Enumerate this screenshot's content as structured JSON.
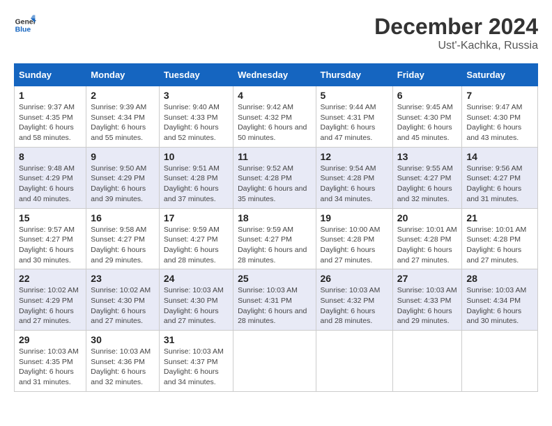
{
  "logo": {
    "line1": "General",
    "line2": "Blue"
  },
  "title": "December 2024",
  "subtitle": "Ust'-Kachka, Russia",
  "days_of_week": [
    "Sunday",
    "Monday",
    "Tuesday",
    "Wednesday",
    "Thursday",
    "Friday",
    "Saturday"
  ],
  "weeks": [
    [
      {
        "day": "1",
        "sunrise": "Sunrise: 9:37 AM",
        "sunset": "Sunset: 4:35 PM",
        "daylight": "Daylight: 6 hours and 58 minutes."
      },
      {
        "day": "2",
        "sunrise": "Sunrise: 9:39 AM",
        "sunset": "Sunset: 4:34 PM",
        "daylight": "Daylight: 6 hours and 55 minutes."
      },
      {
        "day": "3",
        "sunrise": "Sunrise: 9:40 AM",
        "sunset": "Sunset: 4:33 PM",
        "daylight": "Daylight: 6 hours and 52 minutes."
      },
      {
        "day": "4",
        "sunrise": "Sunrise: 9:42 AM",
        "sunset": "Sunset: 4:32 PM",
        "daylight": "Daylight: 6 hours and 50 minutes."
      },
      {
        "day": "5",
        "sunrise": "Sunrise: 9:44 AM",
        "sunset": "Sunset: 4:31 PM",
        "daylight": "Daylight: 6 hours and 47 minutes."
      },
      {
        "day": "6",
        "sunrise": "Sunrise: 9:45 AM",
        "sunset": "Sunset: 4:30 PM",
        "daylight": "Daylight: 6 hours and 45 minutes."
      },
      {
        "day": "7",
        "sunrise": "Sunrise: 9:47 AM",
        "sunset": "Sunset: 4:30 PM",
        "daylight": "Daylight: 6 hours and 43 minutes."
      }
    ],
    [
      {
        "day": "8",
        "sunrise": "Sunrise: 9:48 AM",
        "sunset": "Sunset: 4:29 PM",
        "daylight": "Daylight: 6 hours and 40 minutes."
      },
      {
        "day": "9",
        "sunrise": "Sunrise: 9:50 AM",
        "sunset": "Sunset: 4:29 PM",
        "daylight": "Daylight: 6 hours and 39 minutes."
      },
      {
        "day": "10",
        "sunrise": "Sunrise: 9:51 AM",
        "sunset": "Sunset: 4:28 PM",
        "daylight": "Daylight: 6 hours and 37 minutes."
      },
      {
        "day": "11",
        "sunrise": "Sunrise: 9:52 AM",
        "sunset": "Sunset: 4:28 PM",
        "daylight": "Daylight: 6 hours and 35 minutes."
      },
      {
        "day": "12",
        "sunrise": "Sunrise: 9:54 AM",
        "sunset": "Sunset: 4:28 PM",
        "daylight": "Daylight: 6 hours and 34 minutes."
      },
      {
        "day": "13",
        "sunrise": "Sunrise: 9:55 AM",
        "sunset": "Sunset: 4:27 PM",
        "daylight": "Daylight: 6 hours and 32 minutes."
      },
      {
        "day": "14",
        "sunrise": "Sunrise: 9:56 AM",
        "sunset": "Sunset: 4:27 PM",
        "daylight": "Daylight: 6 hours and 31 minutes."
      }
    ],
    [
      {
        "day": "15",
        "sunrise": "Sunrise: 9:57 AM",
        "sunset": "Sunset: 4:27 PM",
        "daylight": "Daylight: 6 hours and 30 minutes."
      },
      {
        "day": "16",
        "sunrise": "Sunrise: 9:58 AM",
        "sunset": "Sunset: 4:27 PM",
        "daylight": "Daylight: 6 hours and 29 minutes."
      },
      {
        "day": "17",
        "sunrise": "Sunrise: 9:59 AM",
        "sunset": "Sunset: 4:27 PM",
        "daylight": "Daylight: 6 hours and 28 minutes."
      },
      {
        "day": "18",
        "sunrise": "Sunrise: 9:59 AM",
        "sunset": "Sunset: 4:27 PM",
        "daylight": "Daylight: 6 hours and 28 minutes."
      },
      {
        "day": "19",
        "sunrise": "Sunrise: 10:00 AM",
        "sunset": "Sunset: 4:28 PM",
        "daylight": "Daylight: 6 hours and 27 minutes."
      },
      {
        "day": "20",
        "sunrise": "Sunrise: 10:01 AM",
        "sunset": "Sunset: 4:28 PM",
        "daylight": "Daylight: 6 hours and 27 minutes."
      },
      {
        "day": "21",
        "sunrise": "Sunrise: 10:01 AM",
        "sunset": "Sunset: 4:28 PM",
        "daylight": "Daylight: 6 hours and 27 minutes."
      }
    ],
    [
      {
        "day": "22",
        "sunrise": "Sunrise: 10:02 AM",
        "sunset": "Sunset: 4:29 PM",
        "daylight": "Daylight: 6 hours and 27 minutes."
      },
      {
        "day": "23",
        "sunrise": "Sunrise: 10:02 AM",
        "sunset": "Sunset: 4:30 PM",
        "daylight": "Daylight: 6 hours and 27 minutes."
      },
      {
        "day": "24",
        "sunrise": "Sunrise: 10:03 AM",
        "sunset": "Sunset: 4:30 PM",
        "daylight": "Daylight: 6 hours and 27 minutes."
      },
      {
        "day": "25",
        "sunrise": "Sunrise: 10:03 AM",
        "sunset": "Sunset: 4:31 PM",
        "daylight": "Daylight: 6 hours and 28 minutes."
      },
      {
        "day": "26",
        "sunrise": "Sunrise: 10:03 AM",
        "sunset": "Sunset: 4:32 PM",
        "daylight": "Daylight: 6 hours and 28 minutes."
      },
      {
        "day": "27",
        "sunrise": "Sunrise: 10:03 AM",
        "sunset": "Sunset: 4:33 PM",
        "daylight": "Daylight: 6 hours and 29 minutes."
      },
      {
        "day": "28",
        "sunrise": "Sunrise: 10:03 AM",
        "sunset": "Sunset: 4:34 PM",
        "daylight": "Daylight: 6 hours and 30 minutes."
      }
    ],
    [
      {
        "day": "29",
        "sunrise": "Sunrise: 10:03 AM",
        "sunset": "Sunset: 4:35 PM",
        "daylight": "Daylight: 6 hours and 31 minutes."
      },
      {
        "day": "30",
        "sunrise": "Sunrise: 10:03 AM",
        "sunset": "Sunset: 4:36 PM",
        "daylight": "Daylight: 6 hours and 32 minutes."
      },
      {
        "day": "31",
        "sunrise": "Sunrise: 10:03 AM",
        "sunset": "Sunset: 4:37 PM",
        "daylight": "Daylight: 6 hours and 34 minutes."
      },
      null,
      null,
      null,
      null
    ]
  ],
  "colors": {
    "header_bg": "#1565c0",
    "even_row_bg": "#e8eaf6"
  }
}
